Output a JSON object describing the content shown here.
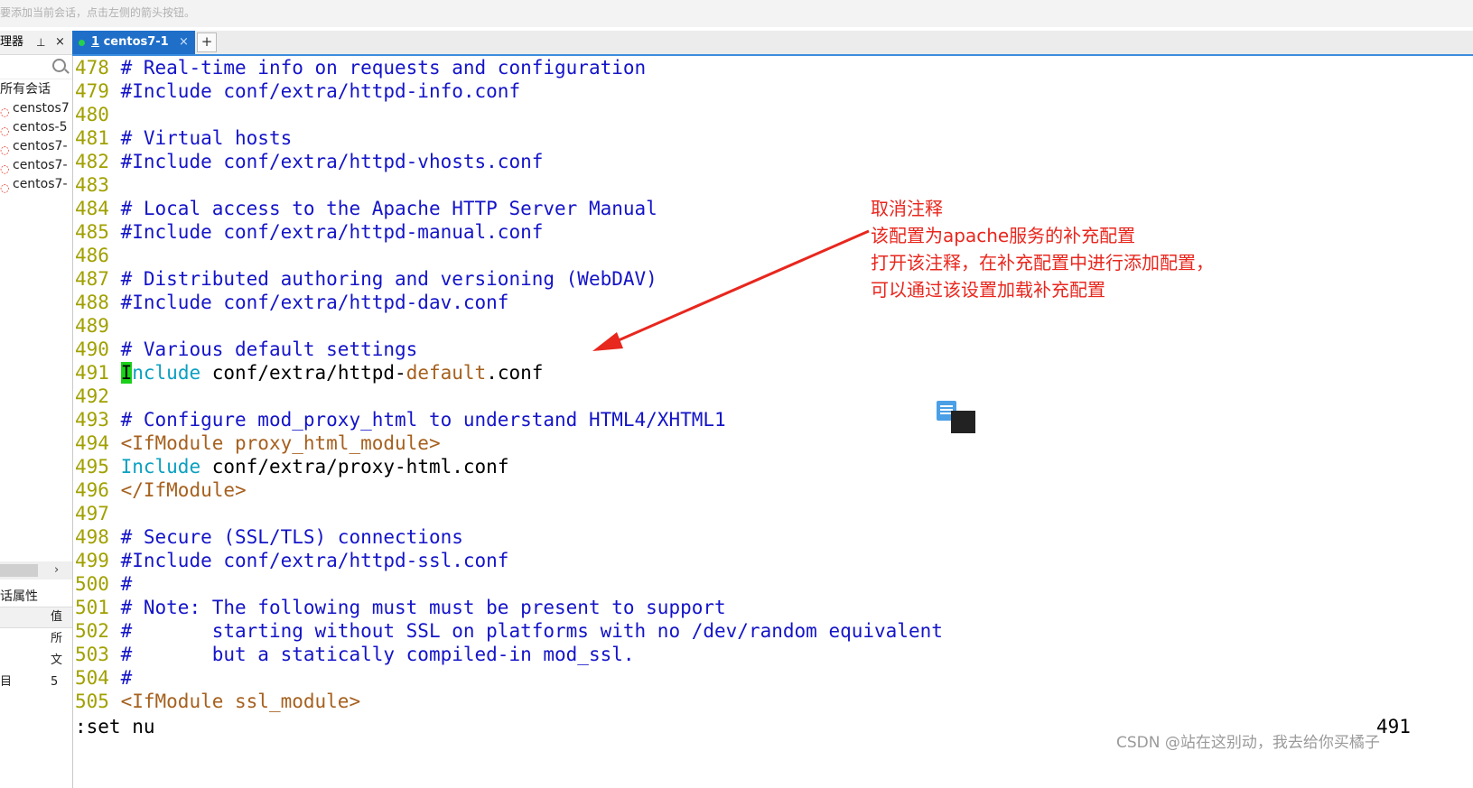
{
  "hint_bar": {
    "text": "要添加当前会话，点击左侧的箭头按钮。"
  },
  "session_manager": {
    "title": "理器",
    "pin_icon": "pin-icon",
    "close_glyph": "×",
    "root_label": "所有会话",
    "sessions": [
      "censtos7",
      "centos-5",
      "centos7-",
      "centos7-",
      "centos7-"
    ],
    "scroll_arrow": "›",
    "props_title": "话属性",
    "props_header": "值",
    "props_rows": [
      {
        "key": "",
        "value": "所"
      },
      {
        "key": "",
        "value": "文"
      },
      {
        "key": "目",
        "value": "5"
      }
    ]
  },
  "tabs": {
    "active": {
      "number": "1",
      "name": " centos7-1",
      "close": "×"
    },
    "add_label": "+"
  },
  "terminal": {
    "lines": [
      {
        "n": "478",
        "segs": [
          {
            "c": "c",
            "t": " # Real-time info on requests and configuration"
          }
        ]
      },
      {
        "n": "479",
        "segs": [
          {
            "c": "c",
            "t": " #Include conf/extra/httpd-info.conf"
          }
        ]
      },
      {
        "n": "480",
        "segs": []
      },
      {
        "n": "481",
        "segs": [
          {
            "c": "c",
            "t": " # Virtual hosts"
          }
        ]
      },
      {
        "n": "482",
        "segs": [
          {
            "c": "c",
            "t": " #Include conf/extra/httpd-vhosts.conf"
          }
        ]
      },
      {
        "n": "483",
        "segs": []
      },
      {
        "n": "484",
        "segs": [
          {
            "c": "c",
            "t": " # Local access to the Apache HTTP Server Manual"
          }
        ]
      },
      {
        "n": "485",
        "segs": [
          {
            "c": "c",
            "t": " #Include conf/extra/httpd-manual.conf"
          }
        ]
      },
      {
        "n": "486",
        "segs": []
      },
      {
        "n": "487",
        "segs": [
          {
            "c": "c",
            "t": " # Distributed authoring and versioning (WebDAV)"
          }
        ]
      },
      {
        "n": "488",
        "segs": [
          {
            "c": "c",
            "t": " #Include conf/extra/httpd-dav.conf"
          }
        ]
      },
      {
        "n": "489",
        "segs": []
      },
      {
        "n": "490",
        "segs": [
          {
            "c": "c",
            "t": " # Various default settings"
          }
        ]
      },
      {
        "n": "491",
        "segs": [
          {
            "c": "t",
            "t": " "
          },
          {
            "c": "cur",
            "t": "I"
          },
          {
            "c": "kw",
            "t": "nclude"
          },
          {
            "c": "t",
            "t": " conf/extra/httpd-"
          },
          {
            "c": "br",
            "t": "default"
          },
          {
            "c": "t",
            "t": ".conf"
          }
        ]
      },
      {
        "n": "492",
        "segs": []
      },
      {
        "n": "493",
        "segs": [
          {
            "c": "c",
            "t": " # Configure mod_proxy_html to understand HTML4/XHTML1"
          }
        ]
      },
      {
        "n": "494",
        "segs": [
          {
            "c": "br",
            "t": " <IfModule proxy_html_module>"
          }
        ]
      },
      {
        "n": "495",
        "segs": [
          {
            "c": "t",
            "t": " "
          },
          {
            "c": "kw",
            "t": "Include"
          },
          {
            "c": "t",
            "t": " conf/extra/proxy-html.conf"
          }
        ]
      },
      {
        "n": "496",
        "segs": [
          {
            "c": "br",
            "t": " </IfModule>"
          }
        ]
      },
      {
        "n": "497",
        "segs": []
      },
      {
        "n": "498",
        "segs": [
          {
            "c": "c",
            "t": " # Secure (SSL/TLS) connections"
          }
        ]
      },
      {
        "n": "499",
        "segs": [
          {
            "c": "c",
            "t": " #Include conf/extra/httpd-ssl.conf"
          }
        ]
      },
      {
        "n": "500",
        "segs": [
          {
            "c": "c",
            "t": " #"
          }
        ]
      },
      {
        "n": "501",
        "segs": [
          {
            "c": "c",
            "t": " # Note: The following must must be present to support"
          }
        ]
      },
      {
        "n": "502",
        "segs": [
          {
            "c": "c",
            "t": " #       starting without SSL on platforms with no /dev/random equivalent"
          }
        ]
      },
      {
        "n": "503",
        "segs": [
          {
            "c": "c",
            "t": " #       but a statically compiled-in mod_ssl."
          }
        ]
      },
      {
        "n": "504",
        "segs": [
          {
            "c": "c",
            "t": " #"
          }
        ]
      },
      {
        "n": "505",
        "segs": [
          {
            "c": "br",
            "t": " <IfModule ssl_module>"
          }
        ]
      }
    ],
    "command": ":set nu",
    "cursor_line": "491"
  },
  "annotation": {
    "lines": [
      "取消注释",
      "该配置为apache服务的补充配置",
      "打开该注释，在补充配置中进行添加配置，",
      "可以通过该设置加载补充配置"
    ],
    "color": "#e8271e"
  },
  "watermark": "CSDN @站在这别动，我去给你买橘子",
  "colors": {
    "line_number": "#a0a000",
    "comment": "#1414c8",
    "keyword": "#0aa0c0",
    "tag": "#a6601e",
    "cursor": "#1ad01a",
    "tab_active": "#1f6fc9"
  }
}
